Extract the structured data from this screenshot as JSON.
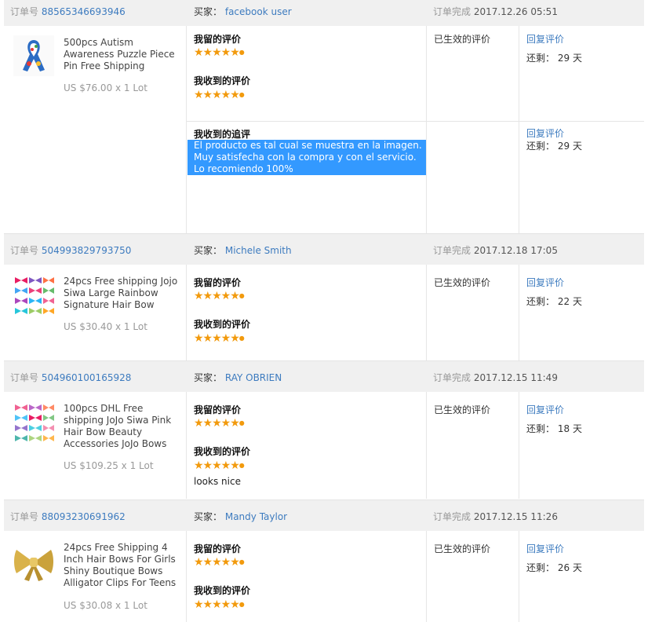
{
  "labels": {
    "order_no": "订单号",
    "buyer": "买家：",
    "completed": "订单完成",
    "my_review": "我留的评价",
    "received_review": "我收到的评价",
    "followup_review": "我收到的追评",
    "status": "已生效的评价",
    "reply": "回复评价",
    "remaining_prefix": "还剩：",
    "days_unit": "天"
  },
  "orders": [
    {
      "order_no": "88565346693946",
      "buyer": "facebook user",
      "completed_at": "2017.12.26 05:51",
      "product": {
        "name": "500pcs Autism Awareness Puzzle Piece Pin Free Shipping",
        "price": "US $76.00 x 1 Lot",
        "icon": "ribbon-icon"
      },
      "rating_given": 5,
      "rating_received": 5,
      "days_left": "29",
      "followup": {
        "text_lines": [
          "El producto es tal cual se muestra en la imagen.",
          "Muy satisfecha con la compra y con el servicio.",
          "Lo recomiendo 100%"
        ],
        "days_left": "29"
      }
    },
    {
      "order_no": "504993829793750",
      "buyer": "Michele Smith",
      "completed_at": "2017.12.18 17:05",
      "product": {
        "name": "24pcs Free shipping Jojo Siwa Large Rainbow Signature Hair Bow",
        "price": "US $30.40 x 1 Lot",
        "icon": "hair-bows-grid-icon"
      },
      "rating_given": 5,
      "rating_received": 5,
      "days_left": "22"
    },
    {
      "order_no": "504960100165928",
      "buyer": "RAY OBRIEN",
      "completed_at": "2017.12.15 11:49",
      "product": {
        "name": "100pcs DHL Free shipping JoJo Siwa Pink Hair Bow Beauty Accessories JoJo Bows",
        "price": "US $109.25 x 1 Lot",
        "icon": "hair-bows-grid-icon"
      },
      "rating_given": 5,
      "rating_received": 5,
      "received_comment": "looks nice",
      "days_left": "18"
    },
    {
      "order_no": "88093230691962",
      "buyer": "Mandy Taylor",
      "completed_at": "2017.12.15 11:26",
      "product": {
        "name": "24pcs Free Shipping 4 Inch Hair Bows For Girls Shiny Boutique Bows Alligator Clips For Teens",
        "price": "US $30.08 x 1 Lot",
        "icon": "gold-bow-icon"
      },
      "rating_given": 5,
      "rating_received": 5,
      "days_left": "26"
    }
  ],
  "colors": {
    "link": "#3d7bbf",
    "star": "#f29a0d",
    "header_bg": "#f0f0f0",
    "selection": "#3399ff"
  }
}
